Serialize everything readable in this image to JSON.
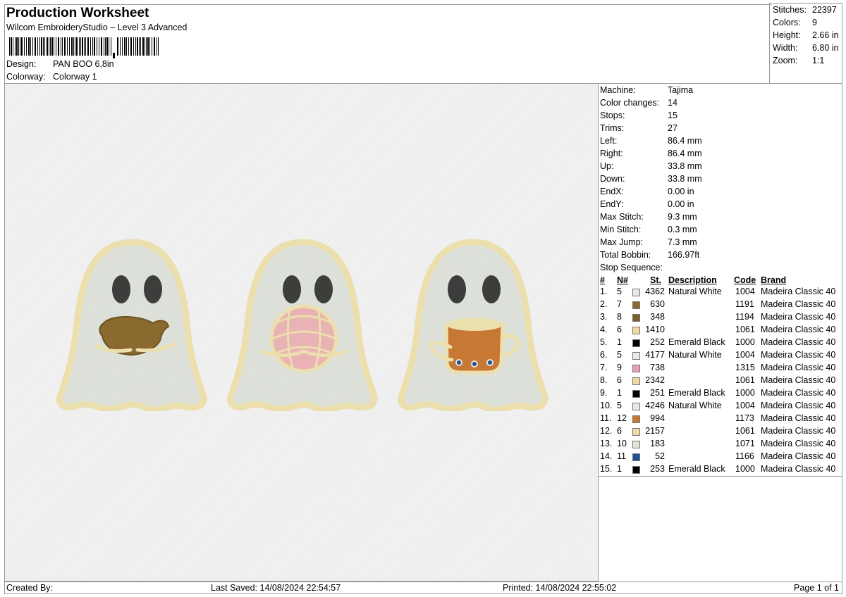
{
  "header": {
    "title": "Production Worksheet",
    "software": "Wilcom EmbroideryStudio – Level 3 Advanced",
    "design_label": "Design:",
    "design_value": "PAN BOO 6,8in",
    "colorway_label": "Colorway:",
    "colorway_value": "Colorway 1"
  },
  "summary": [
    {
      "label": "Stitches:",
      "value": "22397"
    },
    {
      "label": "Colors:",
      "value": "9"
    },
    {
      "label": "Height:",
      "value": "2.66 in"
    },
    {
      "label": "Width:",
      "value": "6.80 in"
    },
    {
      "label": "Zoom:",
      "value": "1:1"
    }
  ],
  "machine": [
    {
      "label": "Machine:",
      "value": "Tajima"
    },
    {
      "label": "Color changes:",
      "value": "14"
    },
    {
      "label": "Stops:",
      "value": "15"
    },
    {
      "label": "Trims:",
      "value": "27"
    },
    {
      "label": "Left:",
      "value": "86.4 mm"
    },
    {
      "label": "Right:",
      "value": "86.4 mm"
    },
    {
      "label": "Up:",
      "value": "33.8 mm"
    },
    {
      "label": "Down:",
      "value": "33.8 mm"
    },
    {
      "label": "EndX:",
      "value": "0.00 in"
    },
    {
      "label": "EndY:",
      "value": "0.00 in"
    },
    {
      "label": "Max Stitch:",
      "value": "9.3 mm"
    },
    {
      "label": "Min Stitch:",
      "value": "0.3 mm"
    },
    {
      "label": "Max Jump:",
      "value": "7.3 mm"
    },
    {
      "label": "Total Bobbin:",
      "value": "166.97ft"
    }
  ],
  "stop_sequence": {
    "title": "Stop Sequence:",
    "headers": {
      "index": "#",
      "needle": "N#",
      "stitches": "St.",
      "description": "Description",
      "code": "Code",
      "brand": "Brand"
    },
    "rows": [
      {
        "index": "1.",
        "needle": "5",
        "color": "#e8e8ea",
        "stitches": "4362",
        "description": "Natural White",
        "code": "1004",
        "brand": "Madeira Classic 40"
      },
      {
        "index": "2.",
        "needle": "7",
        "color": "#8a6a2e",
        "stitches": "630",
        "description": "",
        "code": "1191",
        "brand": "Madeira Classic 40"
      },
      {
        "index": "3.",
        "needle": "8",
        "color": "#7b5f2a",
        "stitches": "348",
        "description": "",
        "code": "1194",
        "brand": "Madeira Classic 40"
      },
      {
        "index": "4.",
        "needle": "6",
        "color": "#f2d9a4",
        "stitches": "1410",
        "description": "",
        "code": "1061",
        "brand": "Madeira Classic 40"
      },
      {
        "index": "5.",
        "needle": "1",
        "color": "#000000",
        "stitches": "252",
        "description": "Emerald Black",
        "code": "1000",
        "brand": "Madeira Classic 40"
      },
      {
        "index": "6.",
        "needle": "5",
        "color": "#e8e8ea",
        "stitches": "4177",
        "description": "Natural White",
        "code": "1004",
        "brand": "Madeira Classic 40"
      },
      {
        "index": "7.",
        "needle": "9",
        "color": "#e9a0b0",
        "stitches": "738",
        "description": "",
        "code": "1315",
        "brand": "Madeira Classic 40"
      },
      {
        "index": "8.",
        "needle": "6",
        "color": "#f2d9a4",
        "stitches": "2342",
        "description": "",
        "code": "1061",
        "brand": "Madeira Classic 40"
      },
      {
        "index": "9.",
        "needle": "1",
        "color": "#000000",
        "stitches": "251",
        "description": "Emerald Black",
        "code": "1000",
        "brand": "Madeira Classic 40"
      },
      {
        "index": "10.",
        "needle": "5",
        "color": "#e8e8ea",
        "stitches": "4246",
        "description": "Natural White",
        "code": "1004",
        "brand": "Madeira Classic 40"
      },
      {
        "index": "11.",
        "needle": "12",
        "color": "#c77834",
        "stitches": "994",
        "description": "",
        "code": "1173",
        "brand": "Madeira Classic 40"
      },
      {
        "index": "12.",
        "needle": "6",
        "color": "#f2d9a4",
        "stitches": "2157",
        "description": "",
        "code": "1061",
        "brand": "Madeira Classic 40"
      },
      {
        "index": "13.",
        "needle": "10",
        "color": "#e4e2da",
        "stitches": "183",
        "description": "",
        "code": "1071",
        "brand": "Madeira Classic 40"
      },
      {
        "index": "14.",
        "needle": "11",
        "color": "#1f4f96",
        "stitches": "52",
        "description": "",
        "code": "1166",
        "brand": "Madeira Classic 40"
      },
      {
        "index": "15.",
        "needle": "1",
        "color": "#000000",
        "stitches": "253",
        "description": "Emerald Black",
        "code": "1000",
        "brand": "Madeira Classic 40"
      }
    ]
  },
  "footer": {
    "created_by": "Created By:",
    "last_saved": "Last Saved: 14/08/2024 22:54:57",
    "printed": "Printed: 14/08/2024 22:55:02",
    "page": "Page 1 of 1"
  },
  "colors": {
    "ghost_fill": "#dfe3dc",
    "ghost_outline": "#ecdfae",
    "eye": "#3b3e3a",
    "bread_brown": "#8a6a2e",
    "concha_pink": "#e9b2b4",
    "mug_orange": "#c77834",
    "flower_blue": "#1f4f96"
  }
}
